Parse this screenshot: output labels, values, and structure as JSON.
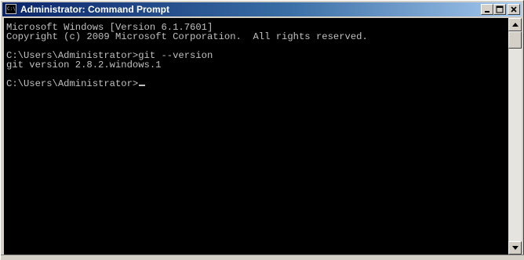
{
  "window": {
    "title": "Administrator: Command Prompt",
    "icon": "cmd-icon",
    "icon_text": "C:\\",
    "controls": [
      "minimize-icon",
      "maximize-icon",
      "close-icon"
    ]
  },
  "console": {
    "lines": [
      "Microsoft Windows [Version 6.1.7601]",
      "Copyright (c) 2009 Microsoft Corporation.  All rights reserved.",
      "",
      "C:\\Users\\Administrator>git --version",
      "git version 2.8.2.windows.1",
      "",
      "C:\\Users\\Administrator>"
    ],
    "colors": {
      "background": "#000000",
      "foreground": "#c0c0c0"
    }
  },
  "colors": {
    "titlebar_start": "#0a246a",
    "titlebar_end": "#a6caf0",
    "frame": "#d4d0c8"
  }
}
